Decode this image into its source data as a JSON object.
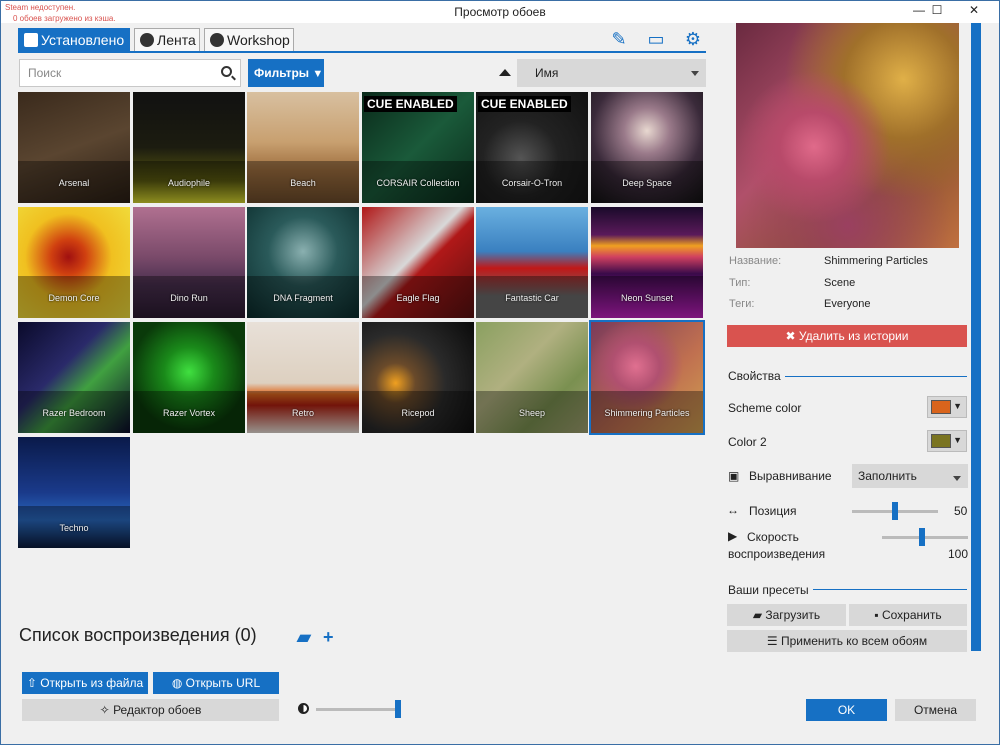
{
  "window": {
    "title": "Просмотр обоев",
    "status_line1": "Steam недоступен.",
    "status_line2": "0 обоев загружено из кэша.",
    "minimize": "—",
    "maximize": "☐",
    "close": "✕"
  },
  "tabs": {
    "installed": "Установлено",
    "feed": "Лента",
    "workshop": "Workshop"
  },
  "toolbar_icons": [
    "brush-icon",
    "monitor-icon",
    "settings-gear-icon"
  ],
  "search": {
    "placeholder": "Поиск"
  },
  "filter_button": "Фильтры",
  "sort": {
    "selected": "Имя"
  },
  "wallpapers": [
    {
      "name": "Arsenal"
    },
    {
      "name": "Audiophile"
    },
    {
      "name": "Beach"
    },
    {
      "name": "CORSAIR Collection"
    },
    {
      "name": "Corsair-O-Tron"
    },
    {
      "name": "Deep Space"
    },
    {
      "name": "Demon Core"
    },
    {
      "name": "Dino Run"
    },
    {
      "name": "DNA Fragment"
    },
    {
      "name": "Eagle Flag"
    },
    {
      "name": "Fantastic Car"
    },
    {
      "name": "Neon Sunset"
    },
    {
      "name": "Razer Bedroom"
    },
    {
      "name": "Razer Vortex"
    },
    {
      "name": "Retro"
    },
    {
      "name": "Ricepod"
    },
    {
      "name": "Sheep"
    },
    {
      "name": "Shimmering Particles"
    },
    {
      "name": "Techno"
    }
  ],
  "cue_badge": "CUE ENABLED",
  "playlist": {
    "title": "Список воспроизведения (0)"
  },
  "bottom": {
    "open_file": "Открыть из файла",
    "open_url": "Открыть URL",
    "editor": "Редактор обоев",
    "brightness_level": 1.0
  },
  "details": {
    "name_key": "Название:",
    "name_val": "Shimmering Particles",
    "type_key": "Тип:",
    "type_val": "Scene",
    "tags_key": "Теги:",
    "tags_val": "Everyone",
    "remove_button": "✖ Удалить из истории"
  },
  "properties": {
    "header": "Свойства",
    "scheme_color_label": "Scheme color",
    "scheme_color": "#d9641c",
    "color2_label": "Color 2",
    "color2": "#7a7420",
    "alignment_label": "Выравнивание",
    "alignment_value": "Заполнить",
    "position_label": "Позиция",
    "position_value": "50",
    "speed_label_line1": "Скорость",
    "speed_label_line2": "воспроизведения",
    "speed_value": "100"
  },
  "presets": {
    "header": "Ваши пресеты",
    "load": "Загрузить",
    "save": "Сохранить",
    "apply_all": "Применить ко всем обоям"
  },
  "dialog": {
    "ok": "OK",
    "cancel": "Отмена"
  },
  "accent_color": "#1670c4",
  "danger_color": "#d9534f"
}
